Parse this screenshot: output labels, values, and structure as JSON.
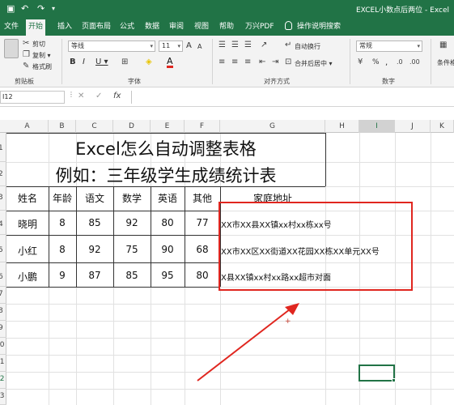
{
  "titlebar": {
    "title": "EXCEL小数点后两位 - Excel",
    "quick_access": [
      "↶",
      "↷"
    ]
  },
  "tabs": [
    {
      "label": "文件",
      "active": false
    },
    {
      "label": "开始",
      "active": true
    },
    {
      "label": "插入",
      "active": false
    },
    {
      "label": "页面布局",
      "active": false
    },
    {
      "label": "公式",
      "active": false
    },
    {
      "label": "数据",
      "active": false
    },
    {
      "label": "审阅",
      "active": false
    },
    {
      "label": "视图",
      "active": false
    },
    {
      "label": "帮助",
      "active": false
    },
    {
      "label": "万兴PDF",
      "active": false
    },
    {
      "label": "操作说明搜索",
      "active": false
    }
  ],
  "ribbon": {
    "clipboard": {
      "cut": "剪切",
      "copy": "复制 ▾",
      "format_painter": "格式刷",
      "label": "剪贴板"
    },
    "font": {
      "name": "等线",
      "size": "11",
      "bold": "B",
      "italic": "I",
      "underline": "U ▾",
      "grow": "A",
      "shrink": "A",
      "font_color_glyph": "A",
      "label": "字体"
    },
    "alignment": {
      "wrap": "自动换行",
      "merge": "合并后居中 ▾",
      "label": "对齐方式"
    },
    "number": {
      "format": "常规",
      "percent": "%",
      "comma": ",",
      "label": "数字"
    },
    "styles": {
      "conditional": "条件格"
    }
  },
  "formula_bar": {
    "name_box": "I12",
    "fx": "fx",
    "cancel": "✕",
    "enter": "✓"
  },
  "columns": [
    "A",
    "B",
    "C",
    "D",
    "E",
    "F",
    "G",
    "H",
    "I",
    "J",
    "K"
  ],
  "selected_column": "I",
  "rows": [
    "1",
    "2",
    "3",
    "4",
    "5",
    "6",
    "7",
    "8",
    "9",
    "10",
    "11",
    "12",
    "13"
  ],
  "sheet": {
    "title1": "Excel怎么自动调整表格",
    "title2": "例如：三年级学生成绩统计表",
    "headers": [
      "姓名",
      "年龄",
      "语文",
      "数学",
      "英语",
      "其他",
      "家庭地址"
    ],
    "records": [
      {
        "name": "晓明",
        "age": "8",
        "chinese": "85",
        "math": "92",
        "english": "80",
        "other": "77",
        "address": "XX市XX县XX镇xx村xx栋xx号"
      },
      {
        "name": "小红",
        "age": "8",
        "chinese": "92",
        "math": "75",
        "english": "90",
        "other": "68",
        "address": "XX市XX区XX街道XX花园XX栋XX单元XX号"
      },
      {
        "name": "小鹏",
        "age": "9",
        "chinese": "87",
        "math": "85",
        "english": "95",
        "other": "80",
        "address": "X县XX镇xx村xx路xx超市对面"
      }
    ]
  },
  "annotation": {
    "cursor": "+",
    "color": "#e0261f"
  },
  "colors": {
    "excel_green": "#217346",
    "ribbon_bg": "#f3f3f3",
    "annotation_red": "#e0261f"
  }
}
